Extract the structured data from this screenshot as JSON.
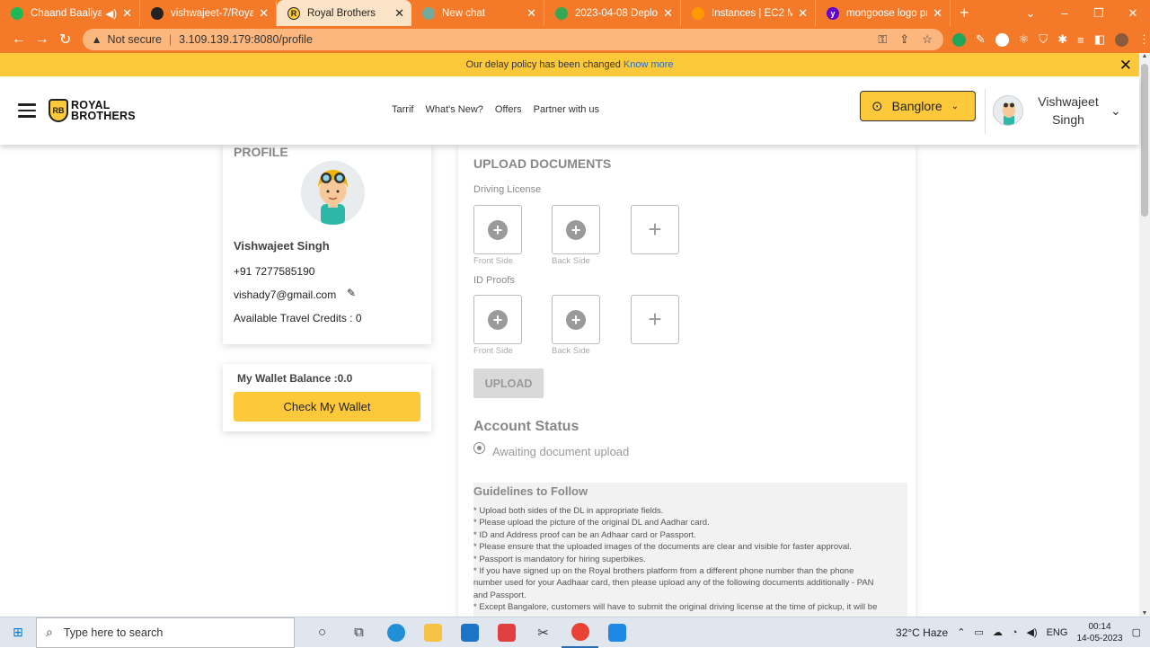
{
  "browser": {
    "tabs": [
      {
        "label": "Chaand Baaliyan -",
        "color": "#1db954",
        "active": false
      },
      {
        "label": "vishwajeet-7/Royal_B",
        "color": "#222222",
        "active": false
      },
      {
        "label": "Royal Brothers",
        "color": "#fdc93a",
        "active": true
      },
      {
        "label": "New chat",
        "color": "#74aa9c",
        "active": false
      },
      {
        "label": "2023-04-08 Deployme",
        "color": "#34a853",
        "active": false
      },
      {
        "label": "Instances | EC2 Mana",
        "color": "#ff9900",
        "active": false
      },
      {
        "label": "mongoose logo png",
        "color": "#6001d2",
        "active": false
      }
    ],
    "security_label": "Not secure",
    "url": "3.109.139.179:8080/profile"
  },
  "notice": {
    "text": "Our delay policy has been changed",
    "link": "Know more"
  },
  "header": {
    "logo_line1": "ROYAL",
    "logo_line2": "BROTHERS",
    "logo_badge": "RB",
    "nav": [
      "Tarrif",
      "What's New?",
      "Offers",
      "Partner with us"
    ],
    "city": "Banglore",
    "user_first": "Vishwajeet",
    "user_last": "Singh"
  },
  "profile": {
    "title": "PROFILE",
    "name": "Vishwajeet Singh",
    "phone": "+91 7277585190",
    "email": "vishady7@gmail.com",
    "credits": "Available Travel Credits : 0"
  },
  "wallet": {
    "balance": "My Wallet Balance :0.0",
    "button": "Check My Wallet"
  },
  "upload": {
    "title": "UPLOAD DOCUMENTS",
    "dl_label": "Driving License",
    "id_label": "ID Proofs",
    "front": "Front Side",
    "back": "Back Side",
    "button": "UPLOAD",
    "account_title": "Account Status",
    "account_status": "Awaiting document upload",
    "guide_title": "Guidelines to Follow",
    "guide_lines": [
      "* Upload both sides of the DL in appropriate fields.",
      "* Please upload the picture of the original DL and Aadhar card.",
      "* ID and Address proof can be an Adhaar card or Passport.",
      "* Please ensure that the uploaded images of the documents are clear and visible for faster approval.",
      "* Passport is mandatory for hiring superbikes.",
      "* If you have signed up on the Royal brothers platform from a different phone number than the phone",
      "number used for your Aadhaar card, then please upload any of the following documents additionally - PAN",
      "and Passport.",
      "* Except Bangalore, customers will have to submit the original driving license at the time of pickup, it will be"
    ]
  },
  "taskbar": {
    "search_placeholder": "Type here to search",
    "weather": "32°C  Haze",
    "lang": "ENG",
    "time": "00:14",
    "date": "14-05-2023"
  }
}
